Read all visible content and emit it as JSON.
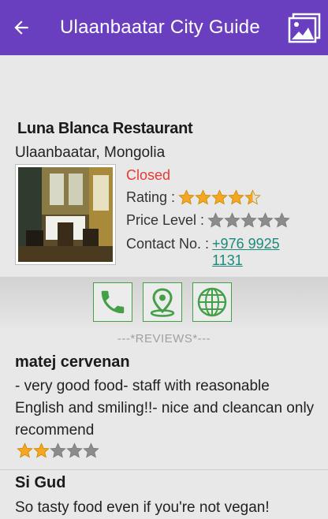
{
  "appbar": {
    "title": "Ulaanbaatar City Guide",
    "back_icon": "arrow-back-icon",
    "gallery_icon": "image-gallery-icon",
    "color": "#6a3fbf"
  },
  "place": {
    "name": "Luna Blanca Restaurant",
    "location": "Ulaanbaatar, Mongolia",
    "status": "Closed",
    "status_color": "#e53935",
    "rating_label": "Rating :",
    "rating_value": 4.5,
    "price_label": "Price Level :",
    "price_value": 0,
    "contact_label": "Contact No. :",
    "phone": "+976 9925 1131"
  },
  "actions": [
    {
      "name": "call",
      "icon": "phone-icon"
    },
    {
      "name": "map",
      "icon": "map-pin-icon"
    },
    {
      "name": "website",
      "icon": "globe-icon"
    }
  ],
  "reviews_header": "---*REVIEWS*---",
  "reviews": [
    {
      "author": "matej cervenan",
      "text": "- very good food- staff with reasonable English and smiling!!- nice and cleancan only recommend",
      "rating": 2
    },
    {
      "author": "Si Gud",
      "text": "So tasty food even if you're not vegan!",
      "rating": null
    }
  ]
}
